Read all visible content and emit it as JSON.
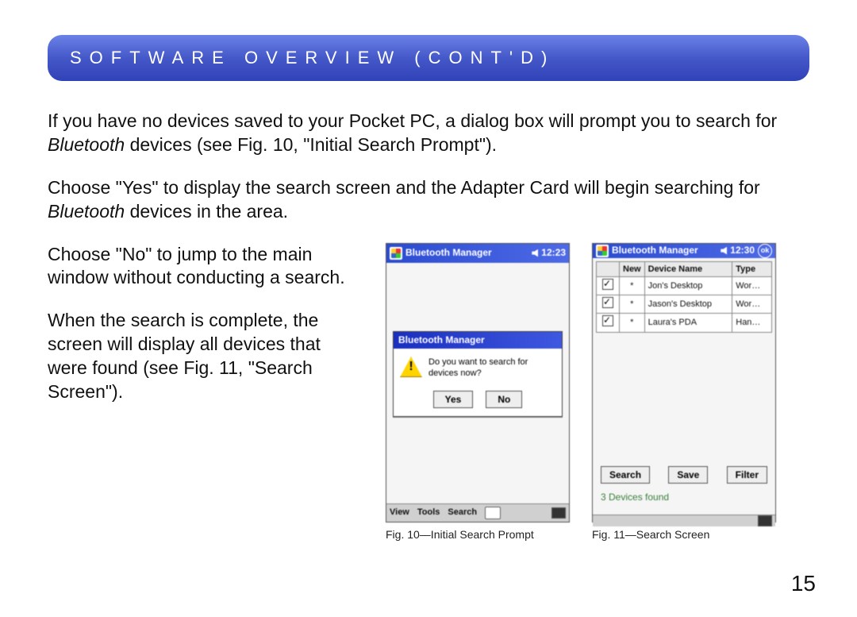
{
  "header": {
    "title": "SOFTWARE OVERVIEW (CONT'D)"
  },
  "para1a": "If you have no devices saved to your Pocket PC, a dialog box will prompt you to search for ",
  "para1b": "Bluetooth",
  "para1c": " devices (see Fig. 10, \"Initial Search Prompt\").",
  "para2a": "Choose \"Yes\" to display the search screen and the Adapter Card will begin searching for ",
  "para2b": "Bluetooth",
  "para2c": " devices in the area.",
  "para3": "Choose \"No\" to jump to the main window without conducting a search.",
  "para4": "When the search is complete, the screen will display all devices that were found (see Fig. 11, \"Search Screen\").",
  "page_number": "15",
  "fig10": {
    "caption": "Fig. 10—Initial Search Prompt",
    "title": "Bluetooth Manager",
    "clock": "12:23",
    "dialog_title": "Bluetooth Manager",
    "dialog_text": "Do you want to search for devices now?",
    "yes": "Yes",
    "no": "No",
    "menu": {
      "view": "View",
      "tools": "Tools",
      "search": "Search"
    }
  },
  "fig11": {
    "caption": "Fig. 11—Search Screen",
    "title": "Bluetooth Manager",
    "clock": "12:30",
    "columns": {
      "new": "New",
      "name": "Device Name",
      "type": "Type"
    },
    "rows": [
      {
        "new": "*",
        "name": "Jon's Desktop",
        "type": "Wor…"
      },
      {
        "new": "*",
        "name": "Jason's Desktop",
        "type": "Wor…"
      },
      {
        "new": "*",
        "name": "Laura's PDA",
        "type": "Han…"
      }
    ],
    "buttons": {
      "search": "Search",
      "save": "Save",
      "filter": "Filter"
    },
    "status": "3 Devices found"
  }
}
